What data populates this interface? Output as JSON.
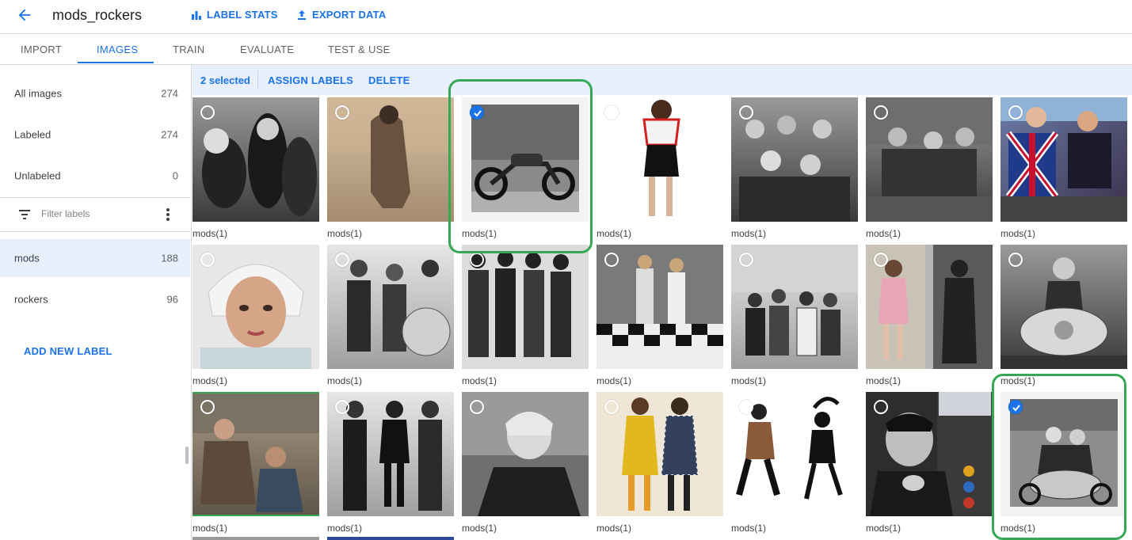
{
  "header": {
    "title": "mods_rockers",
    "label_stats": "LABEL STATS",
    "export_data": "EXPORT DATA"
  },
  "tabs": [
    {
      "label": "IMPORT"
    },
    {
      "label": "IMAGES",
      "active": true
    },
    {
      "label": "TRAIN"
    },
    {
      "label": "EVALUATE"
    },
    {
      "label": "TEST & USE"
    }
  ],
  "sidebar": {
    "all": {
      "label": "All images",
      "count": "274"
    },
    "labeled": {
      "label": "Labeled",
      "count": "274"
    },
    "unlabeled": {
      "label": "Unlabeled",
      "count": "0"
    },
    "filter_placeholder": "Filter labels",
    "labels": [
      {
        "label": "mods",
        "count": "188",
        "selected": true
      },
      {
        "label": "rockers",
        "count": "96"
      }
    ],
    "add_label": "ADD NEW LABEL"
  },
  "actionbar": {
    "selected": "2 selected",
    "assign": "ASSIGN LABELS",
    "delete": "DELETE"
  },
  "grid": {
    "row1": [
      "mods(1)",
      "mods(1)",
      "mods(1)",
      "mods(1)",
      "mods(1)",
      "mods(1)",
      "mods(1)"
    ],
    "row2": [
      "mods(1)",
      "mods(1)",
      "mods(1)",
      "mods(1)",
      "mods(1)",
      "mods(1)",
      "mods(1)"
    ],
    "row3": [
      "mods(1)",
      "mods(1)",
      "mods(1)",
      "mods(1)",
      "mods(1)",
      "mods(1)",
      "mods(1)"
    ],
    "selected_tiles": [
      "row1-3",
      "row3-7"
    ]
  },
  "colors": {
    "accent": "#1a73e8",
    "highlight": "#34a853",
    "selection_bg": "#e8f0fe"
  }
}
